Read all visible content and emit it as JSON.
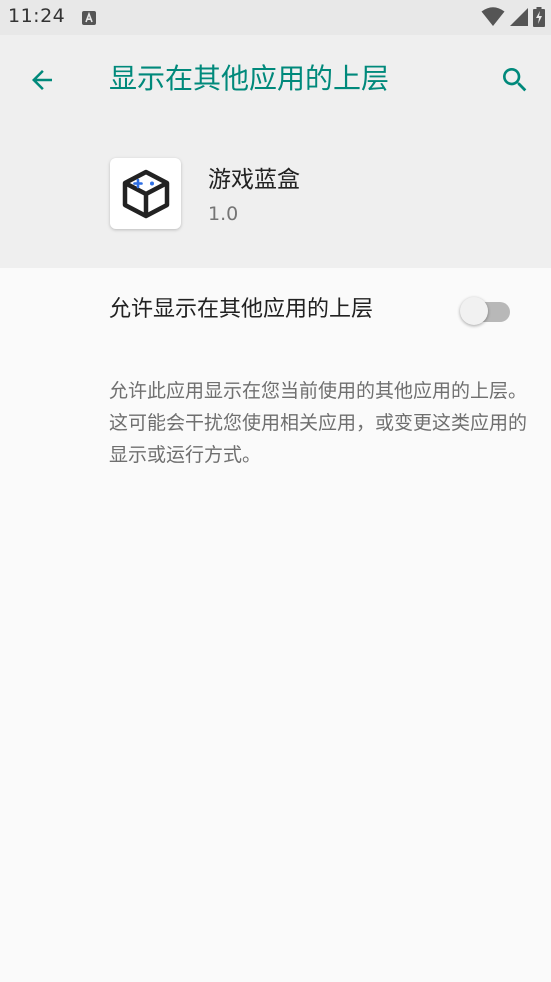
{
  "status_bar": {
    "time": "11:24",
    "icons": [
      "notification-a-icon",
      "wifi-icon",
      "signal-icon",
      "battery-charging-icon"
    ]
  },
  "toolbar": {
    "title": "显示在其他应用的上层",
    "back_icon": "arrow-back-icon",
    "search_icon": "search-icon",
    "accent_color": "#00897b"
  },
  "app": {
    "name": "游戏蓝盒",
    "version": "1.0",
    "icon": "cube-gamepad-icon"
  },
  "setting": {
    "label": "允许显示在其他应用的上层",
    "toggle_on": false
  },
  "description": "允许此应用显示在您当前使用的其他应用的上层。这可能会干扰您使用相关应用，或变更这类应用的显示或运行方式。"
}
